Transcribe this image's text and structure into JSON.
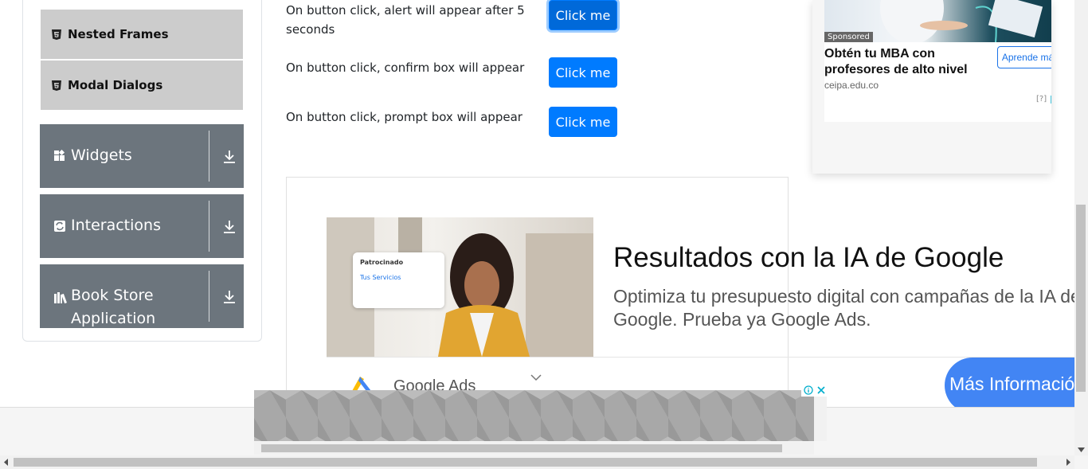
{
  "sidebar": {
    "subitems": [
      {
        "label": "Nested Frames",
        "icon": "html5-icon"
      },
      {
        "label": "Modal Dialogs",
        "icon": "html5-icon"
      }
    ],
    "groups": [
      {
        "label": "Widgets",
        "icon": "widgets-icon"
      },
      {
        "label": "Interactions",
        "icon": "interactions-icon"
      },
      {
        "label": "Book Store Application",
        "label_line1": "Book Store",
        "label_line2": "Application",
        "icon": "library-icon"
      }
    ]
  },
  "alerts": [
    {
      "text": "On button click, alert will appear after 5 seconds",
      "button": "Click me"
    },
    {
      "text": "On button click, confirm box will appear",
      "button": "Click me"
    },
    {
      "text": "On button click, prompt box will appear",
      "button": "Click me"
    }
  ],
  "main_ad": {
    "card_label": "Patrocinado",
    "card_link": "Tus Servicios",
    "headline": "Resultados con la IA de Google",
    "description": "Optimiza tu presupuesto digital con campañas de la IA de Google. Prueba ya Google Ads.",
    "brand": "Google Ads",
    "cta": "Más Informació"
  },
  "side_ad": {
    "badge": "Sponsored",
    "title": "Obtén tu MBA con profesores de alto nivel",
    "domain": "ceipa.edu.co",
    "cta": "Aprende más",
    "adchoices": "[?]"
  },
  "colors": {
    "primary": "#007bff",
    "sidebar_group": "#6c757d",
    "sidebar_sub": "#cccccc",
    "ad_cta": "#4285f4"
  }
}
